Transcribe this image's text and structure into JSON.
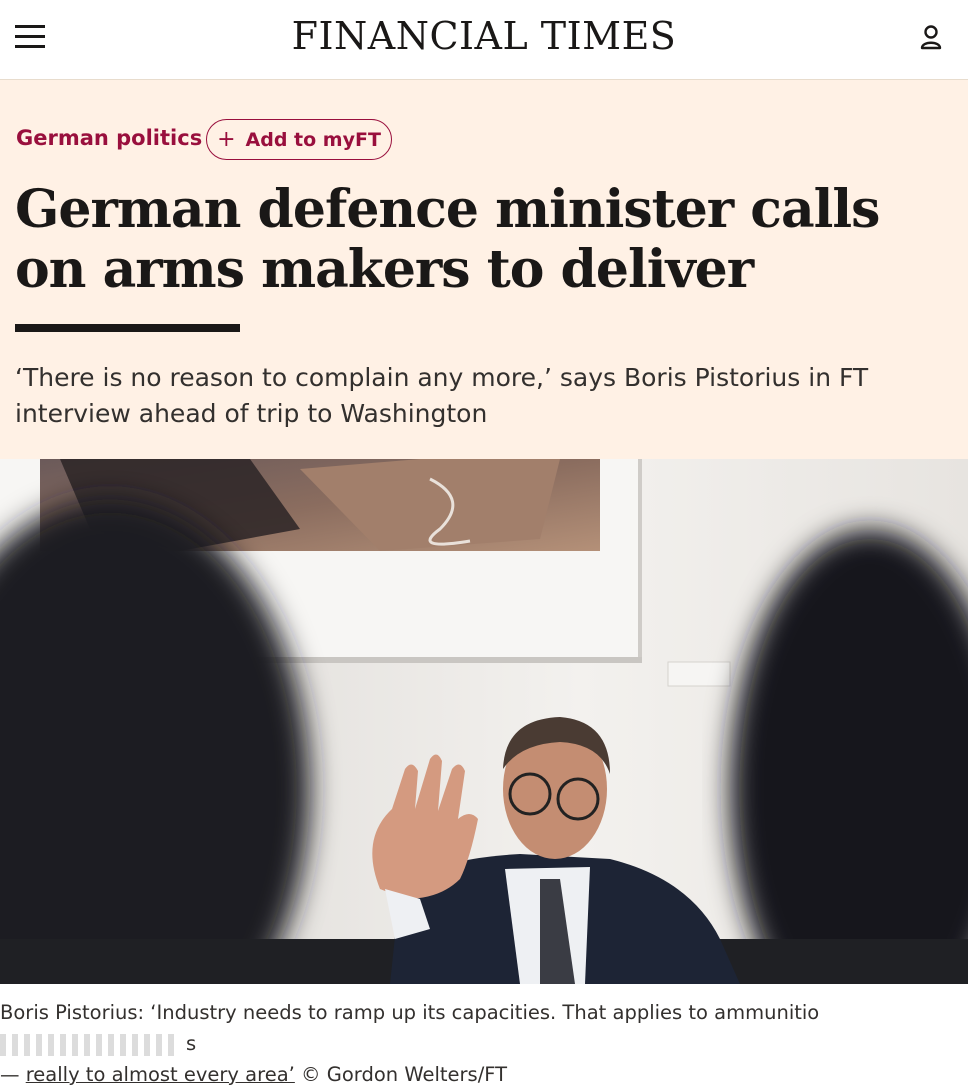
{
  "header": {
    "brand": "FINANCIAL TIMES",
    "menu_icon": "hamburger-menu-icon",
    "account_icon": "user-icon"
  },
  "article": {
    "topic": "German politics",
    "myft_button": {
      "plus": "+",
      "label": "Add to myFT"
    },
    "headline": "German defence minister calls on arms makers to deliver",
    "standfirst": "‘There is no reason to complain any more,’ says Boris Pistorius in FT interview ahead of trip to Washington"
  },
  "image": {
    "caption": "Boris Pistorius: ‘Industry needs to ramp up its capacities. That applies to ammunitio",
    "caption_cont": "s",
    "caption_line2_lead": "— ",
    "caption_line2": "really to almost every area’",
    "credit": " © Gordon Welters/FT"
  },
  "colors": {
    "brand_pink": "#fff1e5",
    "claret": "#990f3d",
    "text": "#1a1817"
  }
}
